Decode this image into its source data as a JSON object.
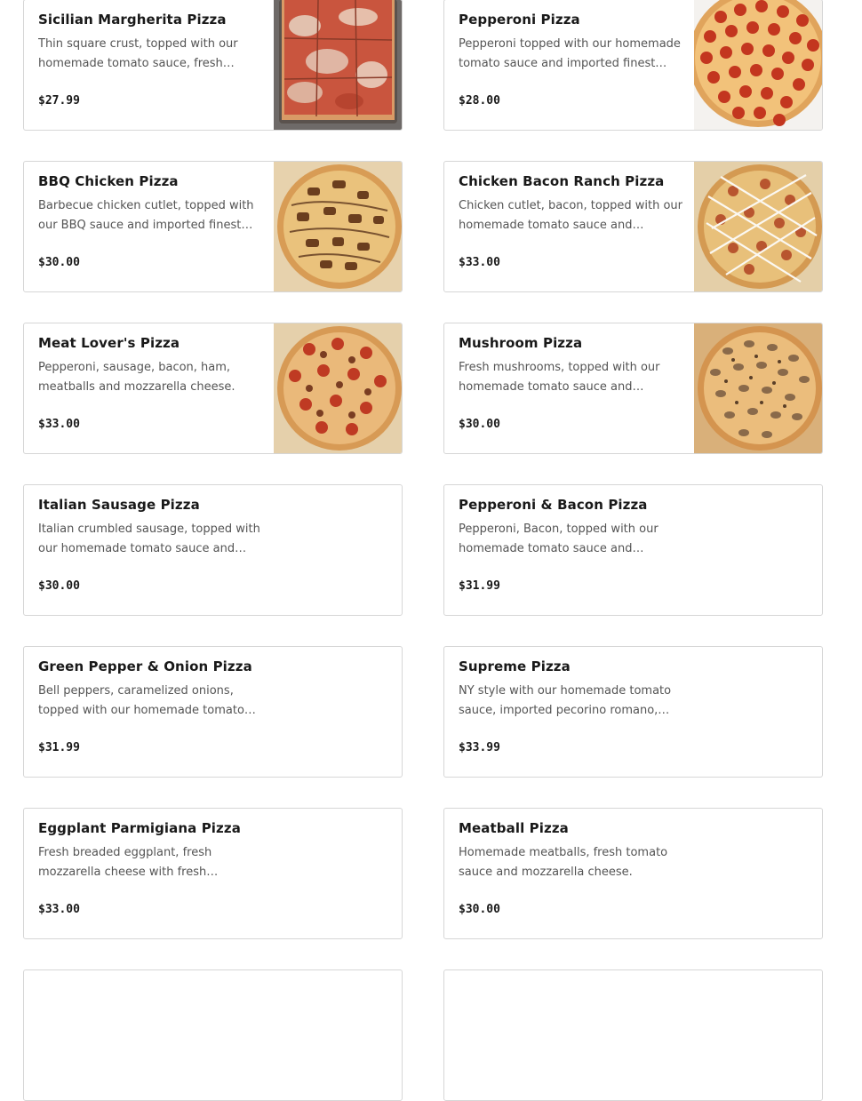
{
  "menu": {
    "items": [
      {
        "name": "Sicilian Margherita Pizza",
        "description": "Thin square crust, topped with our homemade tomato sauce, fresh…",
        "price": "$27.99",
        "image": "sicilian-margherita-pizza-photo"
      },
      {
        "name": "Pepperoni Pizza",
        "description": "Pepperoni topped with our homemade tomato sauce and imported finest…",
        "price": "$28.00",
        "image": "pepperoni-pizza-photo"
      },
      {
        "name": "BBQ Chicken Pizza",
        "description": "Barbecue chicken cutlet, topped with our BBQ sauce and imported finest…",
        "price": "$30.00",
        "image": "bbq-chicken-pizza-photo"
      },
      {
        "name": "Chicken Bacon Ranch Pizza",
        "description": "Chicken cutlet, bacon, topped with our homemade tomato sauce and importe…",
        "price": "$33.00",
        "image": "chicken-bacon-ranch-pizza-photo"
      },
      {
        "name": "Meat Lover's Pizza",
        "description": "Pepperoni, sausage, bacon, ham, meatballs and mozzarella cheese.",
        "price": "$33.00",
        "image": "meat-lovers-pizza-photo"
      },
      {
        "name": "Mushroom Pizza",
        "description": "Fresh mushrooms, topped with our homemade tomato sauce and importe…",
        "price": "$30.00",
        "image": "mushroom-pizza-photo"
      },
      {
        "name": "Italian Sausage Pizza",
        "description": "Italian crumbled sausage, topped with our homemade tomato sauce and…",
        "price": "$30.00",
        "image": null
      },
      {
        "name": "Pepperoni & Bacon Pizza",
        "description": "Pepperoni, Bacon, topped with our homemade tomato sauce and importe…",
        "price": "$31.99",
        "image": null
      },
      {
        "name": "Green Pepper & Onion Pizza",
        "description": "Bell peppers, caramelized onions, topped with our homemade tomato…",
        "price": "$31.99",
        "image": null
      },
      {
        "name": "Supreme Pizza",
        "description": "NY style with our homemade tomato sauce, imported pecorino romano,…",
        "price": "$33.99",
        "image": null
      },
      {
        "name": "Eggplant Parmigiana Pizza",
        "description": "Fresh breaded eggplant, fresh mozzarella cheese with fresh tomato…",
        "price": "$33.00",
        "image": null
      },
      {
        "name": "Meatball Pizza",
        "description": "Homemade meatballs, fresh tomato sauce and mozzarella cheese.",
        "price": "$30.00",
        "image": null
      }
    ]
  },
  "colors": {
    "card_border": "#d6d6d6",
    "title_text": "#191919",
    "description_text": "#545454"
  }
}
